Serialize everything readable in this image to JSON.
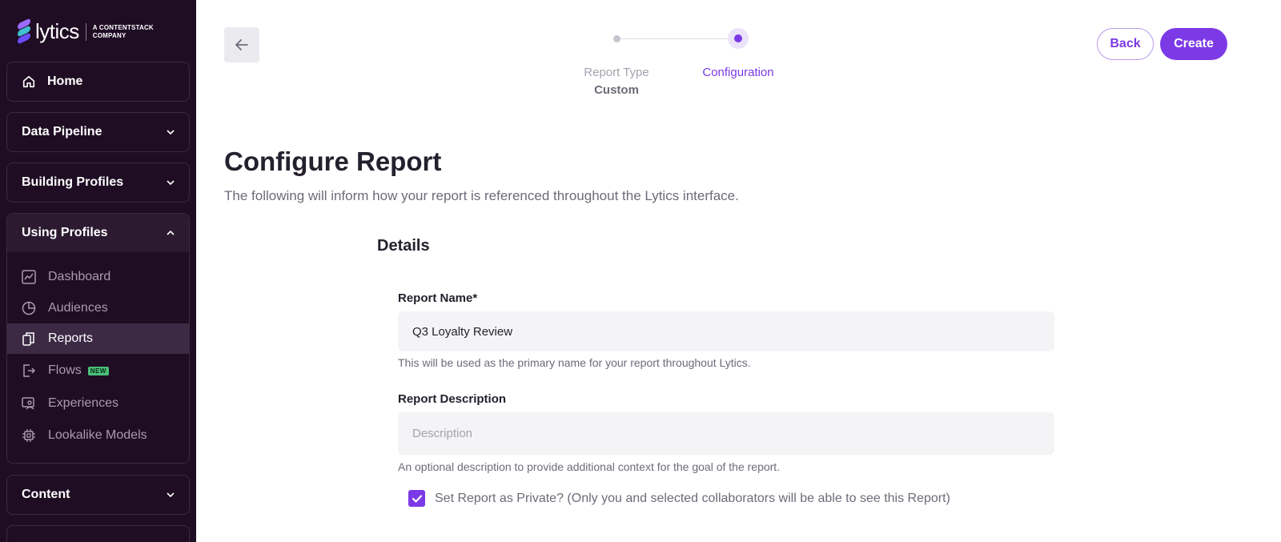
{
  "brand": {
    "name": "lytics",
    "sub_line1": "A CONTENTSTACK",
    "sub_line2": "COMPANY"
  },
  "sidebar": {
    "home": "Home",
    "data_pipeline": "Data Pipeline",
    "building_profiles": "Building Profiles",
    "using_profiles": "Using Profiles",
    "content": "Content",
    "items": [
      {
        "label": "Dashboard",
        "icon": "chart-line-icon"
      },
      {
        "label": "Audiences",
        "icon": "pie-chart-icon"
      },
      {
        "label": "Reports",
        "icon": "copy-document-icon"
      },
      {
        "label": "Flows",
        "icon": "door-arrow-icon",
        "badge": "NEW"
      },
      {
        "label": "Experiences",
        "icon": "monitor-user-icon"
      },
      {
        "label": "Lookalike Models",
        "icon": "chip-icon"
      }
    ],
    "active": "Reports"
  },
  "stepper": {
    "step1_label": "Report Type",
    "step1_value": "Custom",
    "step2_label": "Configuration"
  },
  "actions": {
    "back": "Back",
    "create": "Create"
  },
  "page": {
    "title": "Configure Report",
    "subtitle": "The following will inform how your report is referenced throughout the Lytics interface.",
    "section": "Details"
  },
  "form": {
    "name_label": "Report Name",
    "name_required": "*",
    "name_value": "Q3 Loyalty Review",
    "name_help": "This will be used as the primary name for your report throughout Lytics.",
    "desc_label": "Report Description",
    "desc_placeholder": "Description",
    "desc_help": "An optional description to provide additional context for the goal of the report.",
    "private_label": "Set Report as Private? (Only you and selected collaborators will be able to see this Report)",
    "private_checked": true
  },
  "colors": {
    "accent": "#7c3ae6",
    "sidebar_bg": "#1f0d24",
    "badge_new": "#49c07a"
  }
}
